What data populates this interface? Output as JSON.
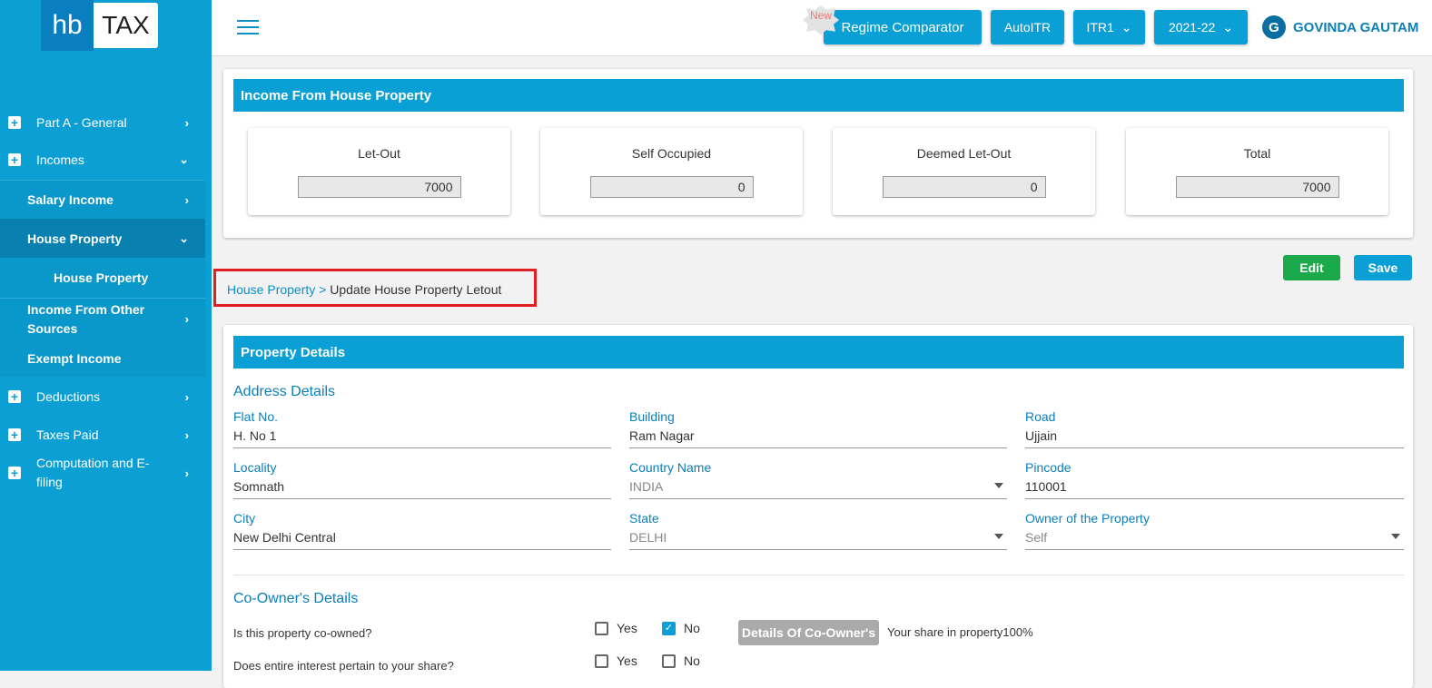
{
  "logo": {
    "part1": "hb",
    "part2": "TAX"
  },
  "sidebar": {
    "items": [
      {
        "label": "Part A - General"
      },
      {
        "label": "Incomes"
      },
      {
        "label": "Salary Income"
      },
      {
        "label": "House Property"
      },
      {
        "label": "House Property"
      },
      {
        "label": "Income From Other Sources"
      },
      {
        "label": "Exempt Income"
      },
      {
        "label": "Deductions"
      },
      {
        "label": "Taxes Paid"
      },
      {
        "label": "Computation and E-filing"
      }
    ]
  },
  "header": {
    "new_badge": "New",
    "regime": "Regime Comparator",
    "autoitr": "AutoITR",
    "itr": "ITR1",
    "year": "2021-22",
    "user_initial": "G",
    "user_name": "GOVINDA GAUTAM"
  },
  "summary": {
    "title": "Income From House Property",
    "cards": [
      {
        "label": "Let-Out",
        "value": "7000"
      },
      {
        "label": "Self Occupied",
        "value": "0"
      },
      {
        "label": "Deemed Let-Out",
        "value": "0"
      },
      {
        "label": "Total",
        "value": "7000"
      }
    ]
  },
  "actions": {
    "edit": "Edit",
    "save": "Save"
  },
  "breadcrumb": {
    "parent": "House Property",
    "separator": ">",
    "current": "Update House Property Letout"
  },
  "property": {
    "title": "Property Details",
    "address_title": "Address Details",
    "fields": [
      {
        "label": "Flat No.",
        "value": "H. No 1"
      },
      {
        "label": "Building",
        "value": "Ram Nagar"
      },
      {
        "label": "Road",
        "value": "Ujjain"
      },
      {
        "label": "Locality",
        "value": "Somnath"
      },
      {
        "label": "Country Name",
        "value": "INDIA"
      },
      {
        "label": "Pincode",
        "value": "110001"
      },
      {
        "label": "City",
        "value": "New Delhi Central"
      },
      {
        "label": "State",
        "value": "DELHI"
      },
      {
        "label": "Owner of the Property",
        "value": "Self"
      }
    ],
    "coowner_title": "Co-Owner's Details",
    "q1": {
      "text": "Is this property co-owned?",
      "yes": "Yes",
      "no": "No",
      "selected": "No"
    },
    "coowner_button": "Details Of Co-Owner's",
    "share": "Your share in property100%",
    "q2": {
      "text": "Does entire interest pertain to your share?",
      "yes": "Yes",
      "no": "No"
    }
  },
  "colors": {
    "primary": "#0aa0d6",
    "sidebar": "#0b9fd3",
    "edit": "#1aa94b",
    "highlight": "#e02020"
  }
}
